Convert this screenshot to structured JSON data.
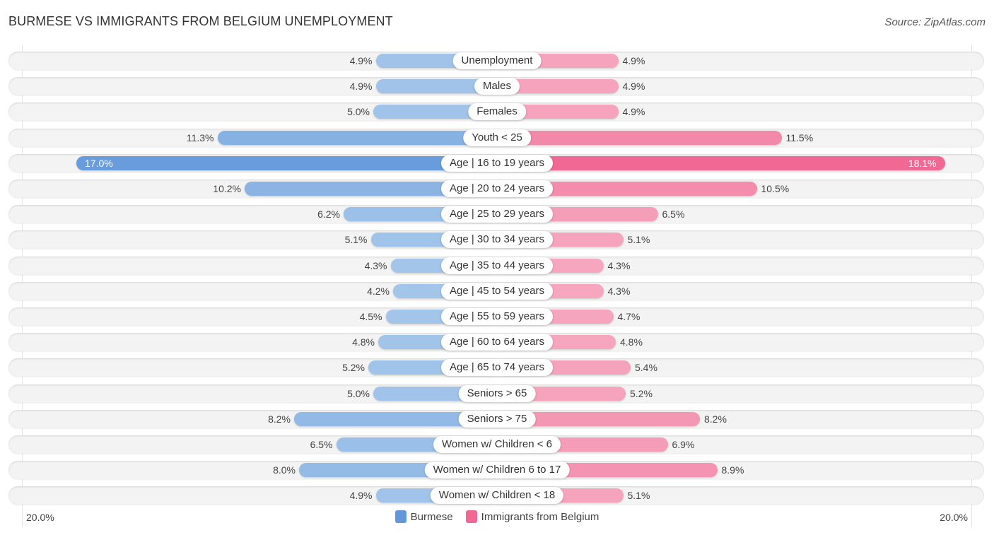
{
  "header": {
    "title": "BURMESE VS IMMIGRANTS FROM BELGIUM UNEMPLOYMENT",
    "source": "Source: ZipAtlas.com"
  },
  "colors": {
    "burmese_light": "#a5c6ea",
    "burmese_strong": "#6399db",
    "belgium_light": "#f6a8c0",
    "belgium_strong": "#f06893"
  },
  "chart_data": {
    "type": "bar",
    "orientation": "horizontal-diverging",
    "title": "BURMESE VS IMMIGRANTS FROM BELGIUM UNEMPLOYMENT",
    "xlabel": "",
    "ylabel": "",
    "xlim": [
      0,
      20.0
    ],
    "axis_labels": {
      "left": "20.0%",
      "right": "20.0%"
    },
    "legend_position": "bottom-center",
    "grid": false,
    "categories": [
      "Unemployment",
      "Males",
      "Females",
      "Youth < 25",
      "Age | 16 to 19 years",
      "Age | 20 to 24 years",
      "Age | 25 to 29 years",
      "Age | 30 to 34 years",
      "Age | 35 to 44 years",
      "Age | 45 to 54 years",
      "Age | 55 to 59 years",
      "Age | 60 to 64 years",
      "Age | 65 to 74 years",
      "Seniors > 65",
      "Seniors > 75",
      "Women w/ Children < 6",
      "Women w/ Children 6 to 17",
      "Women w/ Children < 18"
    ],
    "series": [
      {
        "name": "Burmese",
        "side": "left",
        "values": [
          4.9,
          4.9,
          5.0,
          11.3,
          17.0,
          10.2,
          6.2,
          5.1,
          4.3,
          4.2,
          4.5,
          4.8,
          5.2,
          5.0,
          8.2,
          6.5,
          8.0,
          4.9
        ],
        "labels": [
          "4.9%",
          "4.9%",
          "5.0%",
          "11.3%",
          "17.0%",
          "10.2%",
          "6.2%",
          "5.1%",
          "4.3%",
          "4.2%",
          "4.5%",
          "4.8%",
          "5.2%",
          "5.0%",
          "8.2%",
          "6.5%",
          "8.0%",
          "4.9%"
        ]
      },
      {
        "name": "Immigrants from Belgium",
        "side": "right",
        "values": [
          4.9,
          4.9,
          4.9,
          11.5,
          18.1,
          10.5,
          6.5,
          5.1,
          4.3,
          4.3,
          4.7,
          4.8,
          5.4,
          5.2,
          8.2,
          6.9,
          8.9,
          5.1
        ],
        "labels": [
          "4.9%",
          "4.9%",
          "4.9%",
          "11.5%",
          "18.1%",
          "10.5%",
          "6.5%",
          "5.1%",
          "4.3%",
          "4.3%",
          "4.7%",
          "4.8%",
          "5.4%",
          "5.2%",
          "8.2%",
          "6.9%",
          "8.9%",
          "5.1%"
        ]
      }
    ]
  },
  "legend": {
    "items": [
      "Burmese",
      "Immigrants from Belgium"
    ]
  }
}
